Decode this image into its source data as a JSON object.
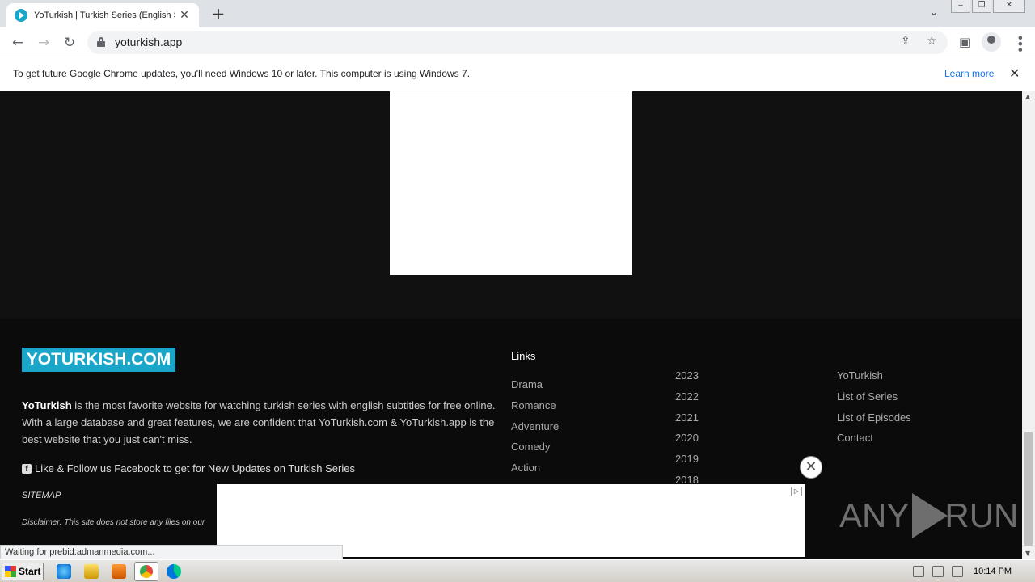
{
  "browser": {
    "tab_title": "YoTurkish | Turkish Series (English Sul",
    "url": "yoturkish.app",
    "infobar_text": "To get future Google Chrome updates, you'll need Windows 10 or later. This computer is using Windows 7.",
    "infobar_link": "Learn more",
    "status_text": "Waiting for prebid.admanmedia.com..."
  },
  "footer": {
    "logo": "YOTURKISH.COM",
    "about_brand": "YoTurkish",
    "about_text": " is the most favorite website for watching turkish series with english subtitles for free online. With a large database and great features, we are confident that YoTurkish.com & YoTurkish.app is the best website that you just can't miss.",
    "facebook_text": "Like & Follow us Facebook to get for New Updates on Turkish Series",
    "sitemap": "SITEMAP",
    "disclaimer": "Disclaimer: This site does not store any files on our",
    "links_heading": "Links",
    "genres": [
      "Drama",
      "Romance",
      "Adventure",
      "Comedy",
      "Action"
    ],
    "years": [
      "2023",
      "2022",
      "2021",
      "2020",
      "2019",
      "2018"
    ],
    "site_links": [
      "YoTurkish",
      "List of Series",
      "List of Episodes",
      "Contact"
    ]
  },
  "watermark": {
    "left": "ANY",
    "right": "RUN"
  },
  "taskbar": {
    "start_label": "Start",
    "clock": "10:14 PM"
  },
  "icons": {
    "back": "arrow-left-icon",
    "forward": "arrow-right-icon",
    "reload": "reload-icon",
    "lock": "lock-icon",
    "share": "share-icon",
    "bookmark": "star-icon",
    "sidepanel": "side-panel-icon",
    "profile": "profile-icon",
    "menu": "kebab-menu-icon"
  }
}
